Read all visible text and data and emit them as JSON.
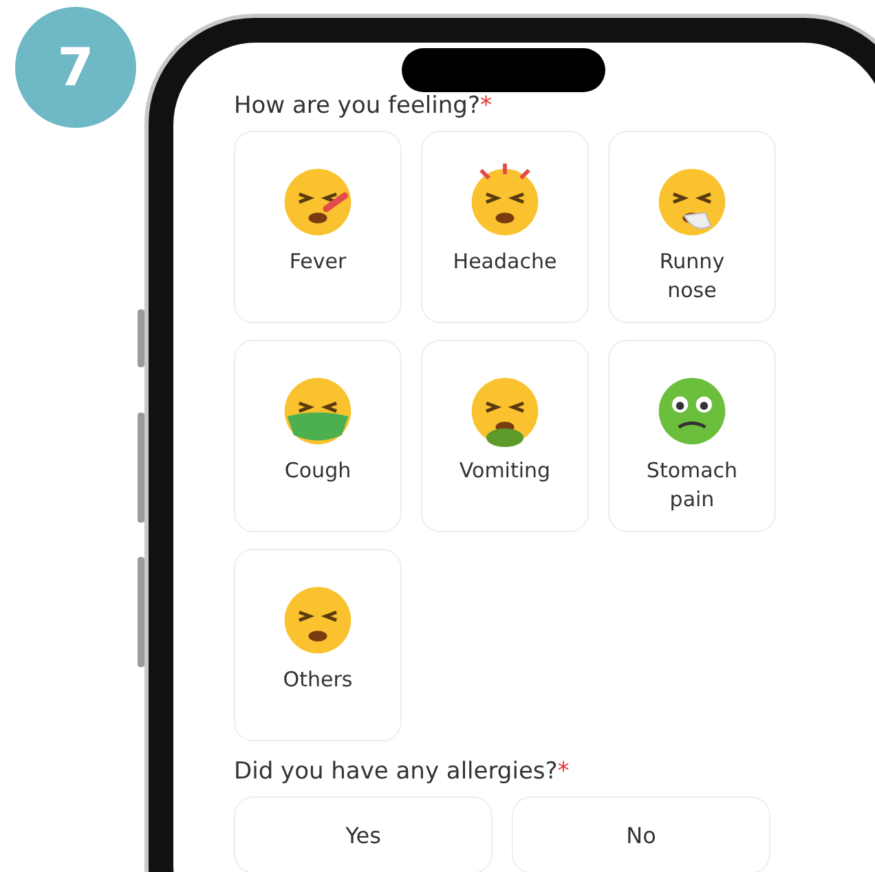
{
  "step_badge": "7",
  "symptom_question": {
    "text": "How are you feeling?",
    "required_mark": "*"
  },
  "symptoms": [
    {
      "label": "Fever",
      "kind": "fever"
    },
    {
      "label": "Headache",
      "kind": "headache"
    },
    {
      "label": "Runny nose",
      "kind": "runny"
    },
    {
      "label": "Cough",
      "kind": "cough"
    },
    {
      "label": "Vomiting",
      "kind": "vomit"
    },
    {
      "label": "Stomach pain",
      "kind": "stomach"
    },
    {
      "label": "Others",
      "kind": "others"
    }
  ],
  "allergy_question": {
    "text": "Did you have any allergies?",
    "required_mark": "*"
  },
  "allergy_options": [
    {
      "label": "Yes"
    },
    {
      "label": "No"
    }
  ]
}
